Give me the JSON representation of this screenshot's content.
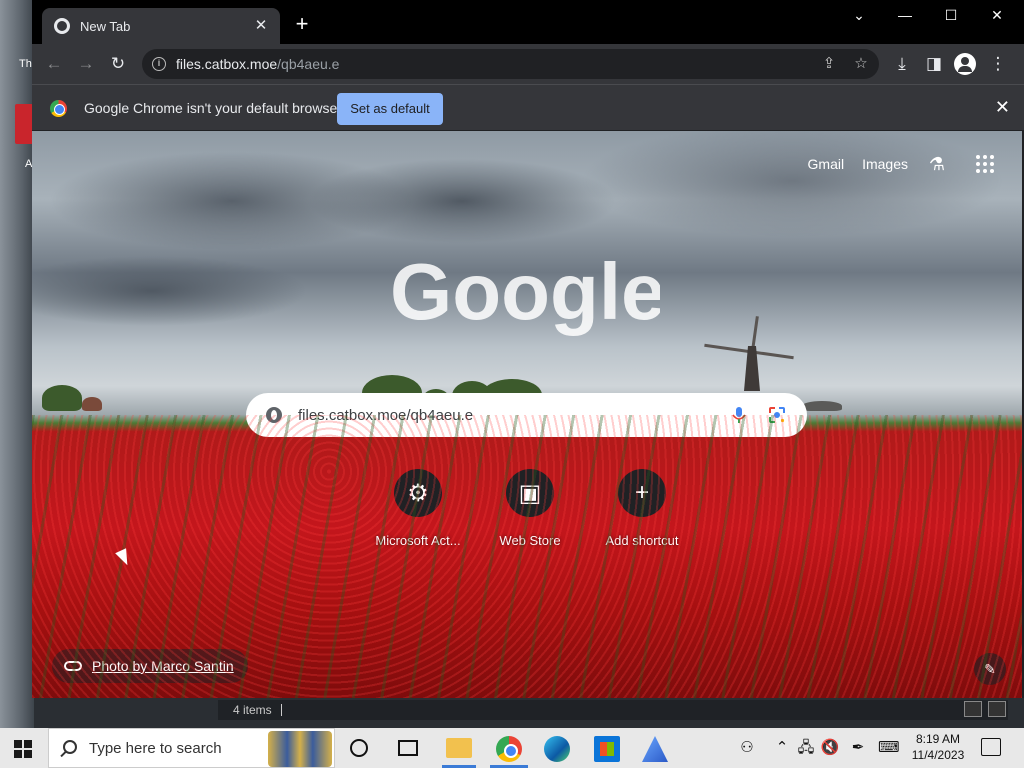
{
  "browser": {
    "tab_title": "New Tab",
    "tab_close": "✕",
    "new_tab": "+",
    "window_controls": {
      "dropdown": "⌄",
      "minimize": "—",
      "maximize": "☐",
      "close": "✕"
    },
    "url_host": "files.catbox.moe",
    "url_path": "/qb4aeu.e"
  },
  "infobar": {
    "message": "Google Chrome isn't your default browser",
    "button": "Set as default",
    "close": "✕"
  },
  "ntp": {
    "links": {
      "gmail": "Gmail",
      "images": "Images"
    },
    "logo": "Google",
    "search_value": "files.catbox.moe/qb4aeu.e",
    "shortcuts": [
      {
        "label": "Microsoft Act...",
        "icon": "⚙"
      },
      {
        "label": "Web Store",
        "icon": "▣"
      },
      {
        "label": "Add shortcut",
        "icon": "+"
      }
    ],
    "attribution": "Photo by Marco Santin",
    "customize_icon": "✎"
  },
  "explorer": {
    "status": "4 items"
  },
  "desktop": {
    "label_th": "Th",
    "label_a": "A"
  },
  "taskbar": {
    "search_placeholder": "Type here to search",
    "time": "8:19 AM",
    "date": "11/4/2023"
  },
  "colors": {
    "infobar_button": "#8ab4f8",
    "toolbar": "#35363a",
    "tabstrip": "#000000"
  }
}
